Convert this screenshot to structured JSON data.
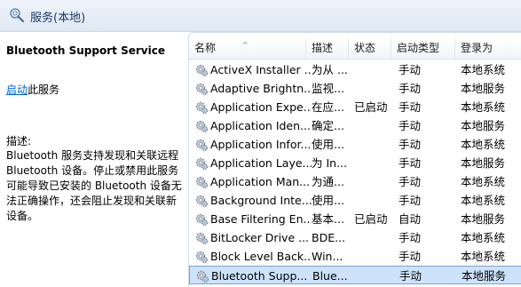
{
  "header": {
    "title": "服务(本地)",
    "icon": "gear-magnifier-icon"
  },
  "left": {
    "service_name": "Bluetooth Support Service",
    "start_link": "启动",
    "start_suffix": "此服务",
    "desc_label": "描述:",
    "description": "Bluetooth 服务支持发现和关联远程 Bluetooth 设备。停止或禁用此服务可能导致已安装的 Bluetooth 设备无法正确操作，还会阻止发现和关联新设备。"
  },
  "columns": {
    "name": "名称",
    "desc": "描述",
    "status": "状态",
    "startup": "启动类型",
    "logon": "登录为"
  },
  "rows": [
    {
      "name": "ActiveX Installer ...",
      "desc": "为从 ...",
      "status": "",
      "startup": "手动",
      "logon": "本地系统"
    },
    {
      "name": "Adaptive Brightn...",
      "desc": "监视...",
      "status": "",
      "startup": "手动",
      "logon": "本地服务"
    },
    {
      "name": "Application Expe...",
      "desc": "在应...",
      "status": "已启动",
      "startup": "手动",
      "logon": "本地系统"
    },
    {
      "name": "Application Iden...",
      "desc": "确定...",
      "status": "",
      "startup": "手动",
      "logon": "本地服务"
    },
    {
      "name": "Application Infor...",
      "desc": "使用...",
      "status": "",
      "startup": "手动",
      "logon": "本地系统"
    },
    {
      "name": "Application Laye...",
      "desc": "为 In...",
      "status": "",
      "startup": "手动",
      "logon": "本地服务"
    },
    {
      "name": "Application Man...",
      "desc": "为通...",
      "status": "",
      "startup": "手动",
      "logon": "本地系统"
    },
    {
      "name": "Background Inte...",
      "desc": "使用...",
      "status": "",
      "startup": "手动",
      "logon": "本地系统"
    },
    {
      "name": "Base Filtering En...",
      "desc": "基本...",
      "status": "已启动",
      "startup": "自动",
      "logon": "本地服务"
    },
    {
      "name": "BitLocker Drive ...",
      "desc": "BDE...",
      "status": "",
      "startup": "手动",
      "logon": "本地系统"
    },
    {
      "name": "Block Level Back...",
      "desc": "Win...",
      "status": "",
      "startup": "手动",
      "logon": "本地系统"
    },
    {
      "name": "Bluetooth Supp...",
      "desc": "Blue...",
      "status": "",
      "startup": "手动",
      "logon": "本地服务"
    }
  ],
  "selected_row_index": 11
}
